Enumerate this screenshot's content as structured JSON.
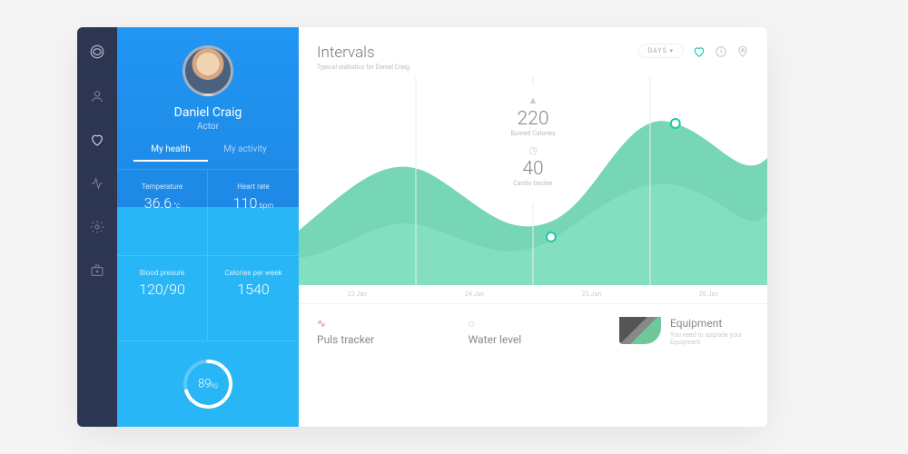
{
  "profile": {
    "name": "Daniel Craig",
    "role": "Actor"
  },
  "tabs": {
    "health": "My health",
    "activity": "My activity"
  },
  "tiles": {
    "temp": {
      "label": "Temperature",
      "value": "36.6",
      "unit": "°c"
    },
    "heart": {
      "label": "Heart rate",
      "value": "110",
      "unit": "bpm"
    },
    "bp": {
      "label": "Blood presure",
      "value": "120/90",
      "unit": ""
    },
    "cal": {
      "label": "Calories per week",
      "value": "1540",
      "unit": ""
    }
  },
  "ring": {
    "value": "89",
    "unit": "kg"
  },
  "header": {
    "title": "Intervals",
    "subtitle": "Typical statistics for Daniel Craig",
    "pill": "DAYS"
  },
  "stats": {
    "calories": {
      "value": "220",
      "label": "Burned Calories"
    },
    "cardio": {
      "value": "40",
      "label": "Cardio tracker"
    }
  },
  "xaxis": [
    "23 Jan",
    "24 Jan",
    "25 Jan",
    "26 Jan"
  ],
  "cards": {
    "puls": {
      "title": "Puls tracker"
    },
    "water": {
      "title": "Water level"
    },
    "equip": {
      "title": "Equipment",
      "sub": "You need to upgrade your Equipment"
    }
  },
  "chart_data": {
    "type": "area",
    "x": [
      "23 Jan",
      "24 Jan",
      "25 Jan",
      "26 Jan"
    ],
    "series": [
      {
        "name": "Burned Calories",
        "values": [
          140,
          220,
          120,
          260
        ]
      },
      {
        "name": "Cardio tracker",
        "values": [
          80,
          40,
          90,
          180
        ]
      }
    ],
    "title": "Intervals",
    "xlabel": "",
    "ylabel": ""
  }
}
